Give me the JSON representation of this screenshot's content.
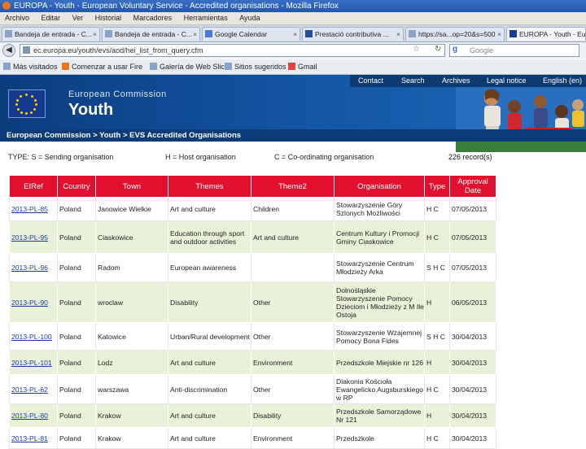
{
  "window": {
    "title": "EUROPA - Youth - European Voluntary Service - Accredited organisations - Mozilla Firefox"
  },
  "menu": [
    "Archivo",
    "Editar",
    "Ver",
    "Historial",
    "Marcadores",
    "Herramientas",
    "Ayuda"
  ],
  "tabs": [
    {
      "label": "Bandeja de entrada - C..."
    },
    {
      "label": "Bandeja de entrada - C..."
    },
    {
      "label": "Google Calendar"
    },
    {
      "label": "Prestació contributiva ..."
    },
    {
      "label": "https://sa...op=20&s=500"
    },
    {
      "label": "EUROPA - Youth - Euro"
    }
  ],
  "nav": {
    "url": "ec.europa.eu/youth/evs/aod/hei_list_from_query.cfm",
    "search_placeholder": "Google"
  },
  "bookmarks": [
    "Más visitados",
    "Comenzar a usar Fire",
    "Galería de Web Slice",
    "Sitios sugeridos",
    "Gmail"
  ],
  "site": {
    "top_links": [
      "Contact",
      "Search",
      "Archives",
      "Legal notice",
      "English (en)"
    ],
    "commission": "European Commission",
    "youth": "Youth",
    "breadcrumb": "European Commission > Youth > EVS Accredited Organisations",
    "types_legend": {
      "s": "TYPE: S = Sending organisation",
      "h": "H = Host organisation",
      "c": "C = Co-ordinating organisation"
    },
    "records": "226 record(s)"
  },
  "table": {
    "headers": [
      "EIRef",
      "Country",
      "Town",
      "Themes",
      "Theme2",
      "Organisation",
      "Type",
      "Approval Date"
    ],
    "rows": [
      {
        "ref": "2013-PL-85",
        "country": "Poland",
        "town": "Janowice Wielkie",
        "themes": "Art and culture",
        "theme2": "Children",
        "org": "Stowarzyszenie Góry Szlonych Możliwości",
        "type": "H C",
        "date": "07/05/2013"
      },
      {
        "ref": "2013-PL-95",
        "country": "Poland",
        "town": "Ciaskowice",
        "themes": "Education through sport and outdoor activities",
        "theme2": "Art and culture",
        "org": "Centrum Kultury i Promocji Gminy Ciaskowice",
        "type": "H C",
        "date": "07/05/2013"
      },
      {
        "ref": "2013-PL-96",
        "country": "Poland",
        "town": "Radom",
        "themes": "European awareness",
        "theme2": "",
        "org": "Stowarzyszenie Centrum Młodzieży Arka",
        "type": "S H C",
        "date": "07/05/2013"
      },
      {
        "ref": "2013-PL-90",
        "country": "Poland",
        "town": "wroclaw",
        "themes": "Disability",
        "theme2": "Other",
        "org": "Dolnośląskie Stowarzyszenie Pomocy Dzieciom i Młodzieży z M Ile Ostoja",
        "type": "H",
        "date": "06/05/2013"
      },
      {
        "ref": "2013-PL-100",
        "country": "Poland",
        "town": "Katowice",
        "themes": "Urban/Rural development",
        "theme2": "Other",
        "org": "Stowarzyszenie Wzajemnej Pomocy Bona Fides",
        "type": "S H C",
        "date": "30/04/2013"
      },
      {
        "ref": "2013-PL-101",
        "country": "Poland",
        "town": "Lodz",
        "themes": "Art and culture",
        "theme2": "Environment",
        "org": "Przedszkole Miejskie nr 126",
        "type": "H",
        "date": "30/04/2013"
      },
      {
        "ref": "2013-PL-62",
        "country": "Poland",
        "town": "warszawa",
        "themes": "Anti-discrimination",
        "theme2": "Other",
        "org": "Diakonia Kościoła Ewangelicko Augsburskiego w RP",
        "type": "H C",
        "date": "30/04/2013"
      },
      {
        "ref": "2013-PL-80",
        "country": "Poland",
        "town": "Krakow",
        "themes": "Art and culture",
        "theme2": "Disability",
        "org": "Przedszkole Samorządowe Nr 121",
        "type": "H",
        "date": "30/04/2013"
      },
      {
        "ref": "2013-PL-81",
        "country": "Poland",
        "town": "Krakow",
        "themes": "Art and culture",
        "theme2": "Environment",
        "org": "Przedszkole",
        "type": "H C",
        "date": "30/04/2013"
      }
    ]
  },
  "colors": {
    "header_red": "#e30f2e",
    "row_green": "#e9f2d9",
    "eu_blue": "#0b3d7d"
  }
}
